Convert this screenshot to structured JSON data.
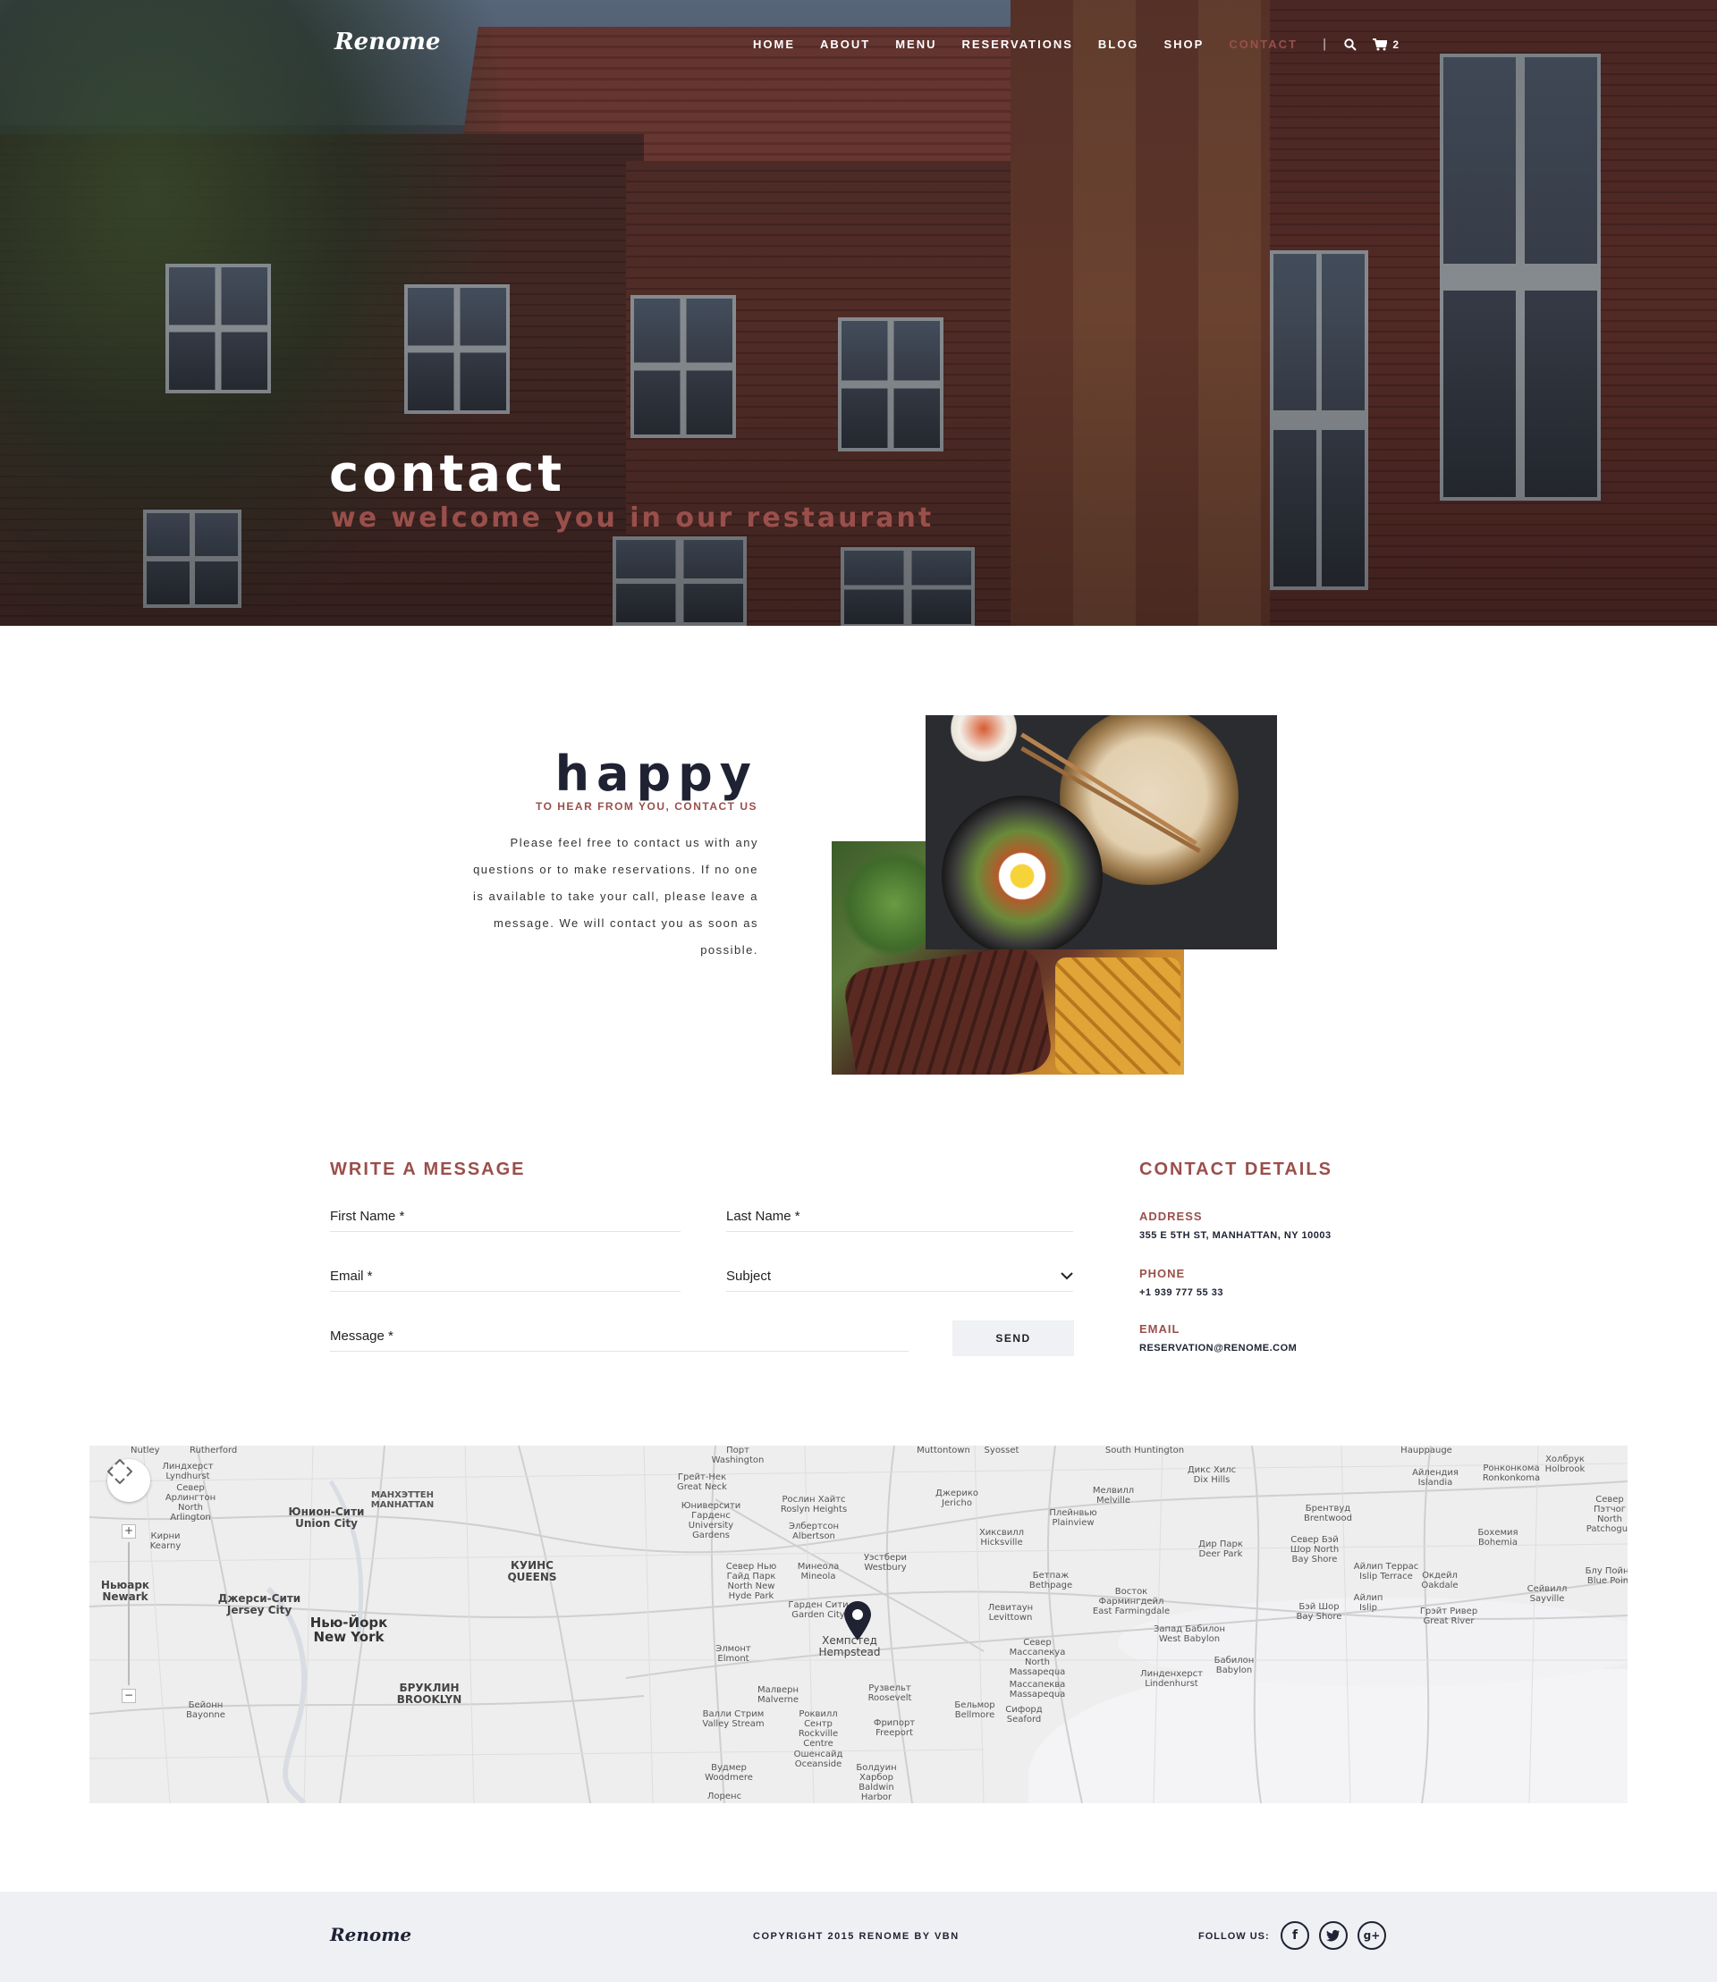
{
  "header": {
    "logo": "Renome",
    "nav": [
      {
        "label": "HOME",
        "active": false
      },
      {
        "label": "ABOUT",
        "active": false
      },
      {
        "label": "MENU",
        "active": false
      },
      {
        "label": "RESERVATIONS",
        "active": false
      },
      {
        "label": "BLOG",
        "active": false
      },
      {
        "label": "SHOP",
        "active": false
      },
      {
        "label": "CONTACT",
        "active": true
      }
    ],
    "separator": "|",
    "search_icon": "search-icon",
    "cart_icon": "cart-icon",
    "cart_count": "2"
  },
  "hero": {
    "title": "contact",
    "subtitle": "we welcome you in our restaurant"
  },
  "intro": {
    "title": "happy",
    "subtitle": "TO HEAR FROM YOU, CONTACT US",
    "text": "Please feel free to contact us with any questions or to make reservations. If no one is available to take your call, please leave a message. We will contact you as soon as possible."
  },
  "form": {
    "title": "WRITE A MESSAGE",
    "first_name": "First Name *",
    "last_name": "Last Name *",
    "email": "Email *",
    "subject": "Subject",
    "message": "Message *",
    "send": "SEND"
  },
  "contact": {
    "title": "CONTACT DETAILS",
    "address_label": "ADDRESS",
    "address": "355 E 5TH ST, MANHATTAN, NY 10003",
    "phone_label": "PHONE",
    "phone": "+1 939 777 55 33",
    "email_label": "EMAIL",
    "email": "RESERVATION@RENOME.COM"
  },
  "map": {
    "labels": {
      "nutley": "Nutley",
      "rutherford": "Rutherford",
      "lyndhurst": "Линдхерст Lyndhurst",
      "north_arlington": "Север Арлингтон North Arlington",
      "kearny": "Кирни Kearny",
      "union_city": "Юнион-Сити Union City",
      "newark": "Ньюарк Newark",
      "jersey_city": "Джерси-Сити Jersey City",
      "new_york": "Нью-Йорк New York",
      "bayonne": "Бейонн Bayonne",
      "manhattan": "МАНХЭТТЕН MANHATTAN",
      "queens": "КУИНС QUEENS",
      "brooklyn": "БРУКЛИН BROOKLYN",
      "port_washington": "Порт Washington",
      "great_neck": "Грейт-Нек Great Neck",
      "roslyn_heights": "Рослин Хайтс Roslyn Heights",
      "university_gardens": "Юниверсити Гарденс University Gardens",
      "albertson": "Элбертсон Albertson",
      "north_new_hyde_park": "Север Нью Гайд Парк North New Hyde Park",
      "mineola": "Минеола Mineola",
      "westbury": "Уэстбери Westbury",
      "jericho": "Джерико Jericho",
      "hicksville": "Хиксвилл Hicksville",
      "plainview": "Плейнвью Plainview",
      "bethpage": "Бетпаж Bethpage",
      "levittown": "Левитаун Levittown",
      "hempstead": "Хемпстед Hempstead",
      "elmont": "Элмонт Elmont",
      "malverne": "Малверн Malverne",
      "roosevelt": "Рузвельт Roosevelt",
      "freeport": "Фрипорт Freeport",
      "bellmore": "Бельмор Bellmore",
      "seaford": "Сифорд Seaford",
      "north_massapequa": "Север Массапекуа North Massapequa",
      "massapequa": "Массапеква Massapequa",
      "east_farmingdale": "Восток Фармингдейл East Farmingdale",
      "west_babylon": "Запад Бабилон West Babylon",
      "babylon": "Бабилон Babylon",
      "lindenhurst": "Линденхерст Lindenhurst",
      "melville": "Мелвилл Melville",
      "dix_hills": "Дикс Хилс Dix Hills",
      "deer_park": "Дир Парк Deer Park",
      "brentwood": "Брентвуд Brentwood",
      "north_bay_shore": "Север Бэй Шор North Bay Shore",
      "bay_shore": "Бэй Шор Bay Shore",
      "islip_terrace": "Айлип Террас Islip Terrace",
      "islip": "Айлип Islip",
      "oakdale": "Окдейл Oakdale",
      "great_river": "Грэйт Ривер Great River",
      "bohemia": "Бохемия Bohemia",
      "sayville": "Сейвилл Sayville",
      "holbrook": "Холбрук Holbrook",
      "ronkonkoma": "Ронконкома Ronkonkoma",
      "islandia": "Айлендия Islandia",
      "hauppauge": "Hauppauge",
      "south_huntington": "South Huntington",
      "muttontown": "Muttontown",
      "syosset": "Syosset",
      "valley_stream": "Валли Стрим Valley Stream",
      "rockville_centre": "Роквилл Сентр Rockville Centre",
      "oceanside": "Ошенсайд Oceanside",
      "baldwin_harbor": "Болдуин Харбор Baldwin Harbor",
      "woodmere": "Вудмер Woodmere",
      "garden_city": "Гарден Сити Garden City",
      "lawrence": "Лоренс",
      "blue_point": "Блу Пойнт Blue Point",
      "patchogue": "Север Пэтчог North Patchogue"
    }
  },
  "footer": {
    "logo": "Renome",
    "copyright": "COPYRIGHT 2015 RENOME BY VBN",
    "follow": "FOLLOW US:",
    "social": [
      {
        "icon": "facebook-icon",
        "glyph": "f"
      },
      {
        "icon": "twitter-icon",
        "glyph": "t"
      },
      {
        "icon": "google-plus-icon",
        "glyph": "g+"
      }
    ]
  },
  "colors": {
    "accent": "#9a4f4b",
    "dark": "#1f2233",
    "footer_bg": "#eef0f3"
  }
}
